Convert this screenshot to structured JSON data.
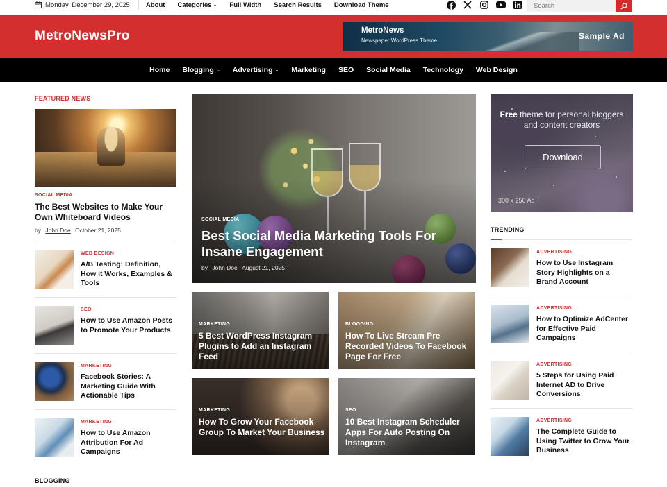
{
  "topbar": {
    "date": "Monday, December 29, 2025",
    "nav": [
      "About",
      "Categories",
      "Full Width",
      "Search Results",
      "Download Theme"
    ],
    "social_icons": [
      "facebook-icon",
      "x-icon",
      "instagram-icon",
      "youtube-icon",
      "linkedin-icon"
    ],
    "search_placeholder": "Search"
  },
  "header": {
    "logo": "MetroNewsPro",
    "ad_title": "MetroNews",
    "ad_subtitle": "Newspaper WordPress Theme",
    "ad_label": "Sample Ad"
  },
  "mainnav": [
    "Home",
    "Blogging",
    "Advertising",
    "Marketing",
    "SEO",
    "Social Media",
    "Technology",
    "Web Design"
  ],
  "featured": {
    "section_label": "FEATURED NEWS",
    "category": "SOCIAL MEDIA",
    "title": "The Best Websites to Make Your Own Whiteboard Videos",
    "by": "by",
    "author": "John Doe",
    "date": "October 21, 2025"
  },
  "left_list": [
    {
      "category": "WEB DESIGN",
      "title": "A/B Testing: Definition, How it Works, Examples & Tools"
    },
    {
      "category": "SEO",
      "title": "How to Use Amazon Posts to Promote Your Products"
    },
    {
      "category": "MARKETING",
      "title": "Facebook Stories: A Marketing Guide With Actionable Tips"
    },
    {
      "category": "MARKETING",
      "title": "How to Use Amazon Attribution For Ad Campaigns"
    }
  ],
  "blogging_label": "BLOGGING",
  "hero": {
    "category": "SOCIAL MEDIA",
    "title": "Best Social Media Marketing Tools For Insane Engagement",
    "by": "by",
    "author": "John Doe",
    "date": "August 21, 2025"
  },
  "cards": [
    {
      "category": "MARKETING",
      "title": "5 Best WordPress Instagram Plugins to Add an Instagram Feed"
    },
    {
      "category": "BLOGGING",
      "title": "How To Live Stream Pre Recorded Videos To Facebook Page For Free"
    },
    {
      "category": "MARKETING",
      "title": "How To Grow Your Facebook Group To Market Your Business"
    },
    {
      "category": "SEO",
      "title": "10 Best Instagram Scheduler Apps For Auto Posting On Instagram"
    }
  ],
  "ad_box": {
    "text_bold": "Free",
    "text_line1": " theme for personal bloggers",
    "text_line2": "and content creators",
    "button": "Download",
    "size": "300 x 250 Ad"
  },
  "trending": {
    "label": "TRENDING",
    "items": [
      {
        "category": "ADVERTISING",
        "title": "How to Use Instagram Story Highlights on a Brand Account"
      },
      {
        "category": "ADVERTISING",
        "title": "How to Optimize AdCenter for Effective Paid Campaigns"
      },
      {
        "category": "ADVERTISING",
        "title": "5 Steps for Using Paid Internet AD to Drive Conversions"
      },
      {
        "category": "ADVERTISING",
        "title": "The Complete Guide to Using Twitter to Grow Your Business"
      }
    ]
  },
  "colors": {
    "brand_red": "#d32f2f",
    "nav_black": "#000000"
  }
}
